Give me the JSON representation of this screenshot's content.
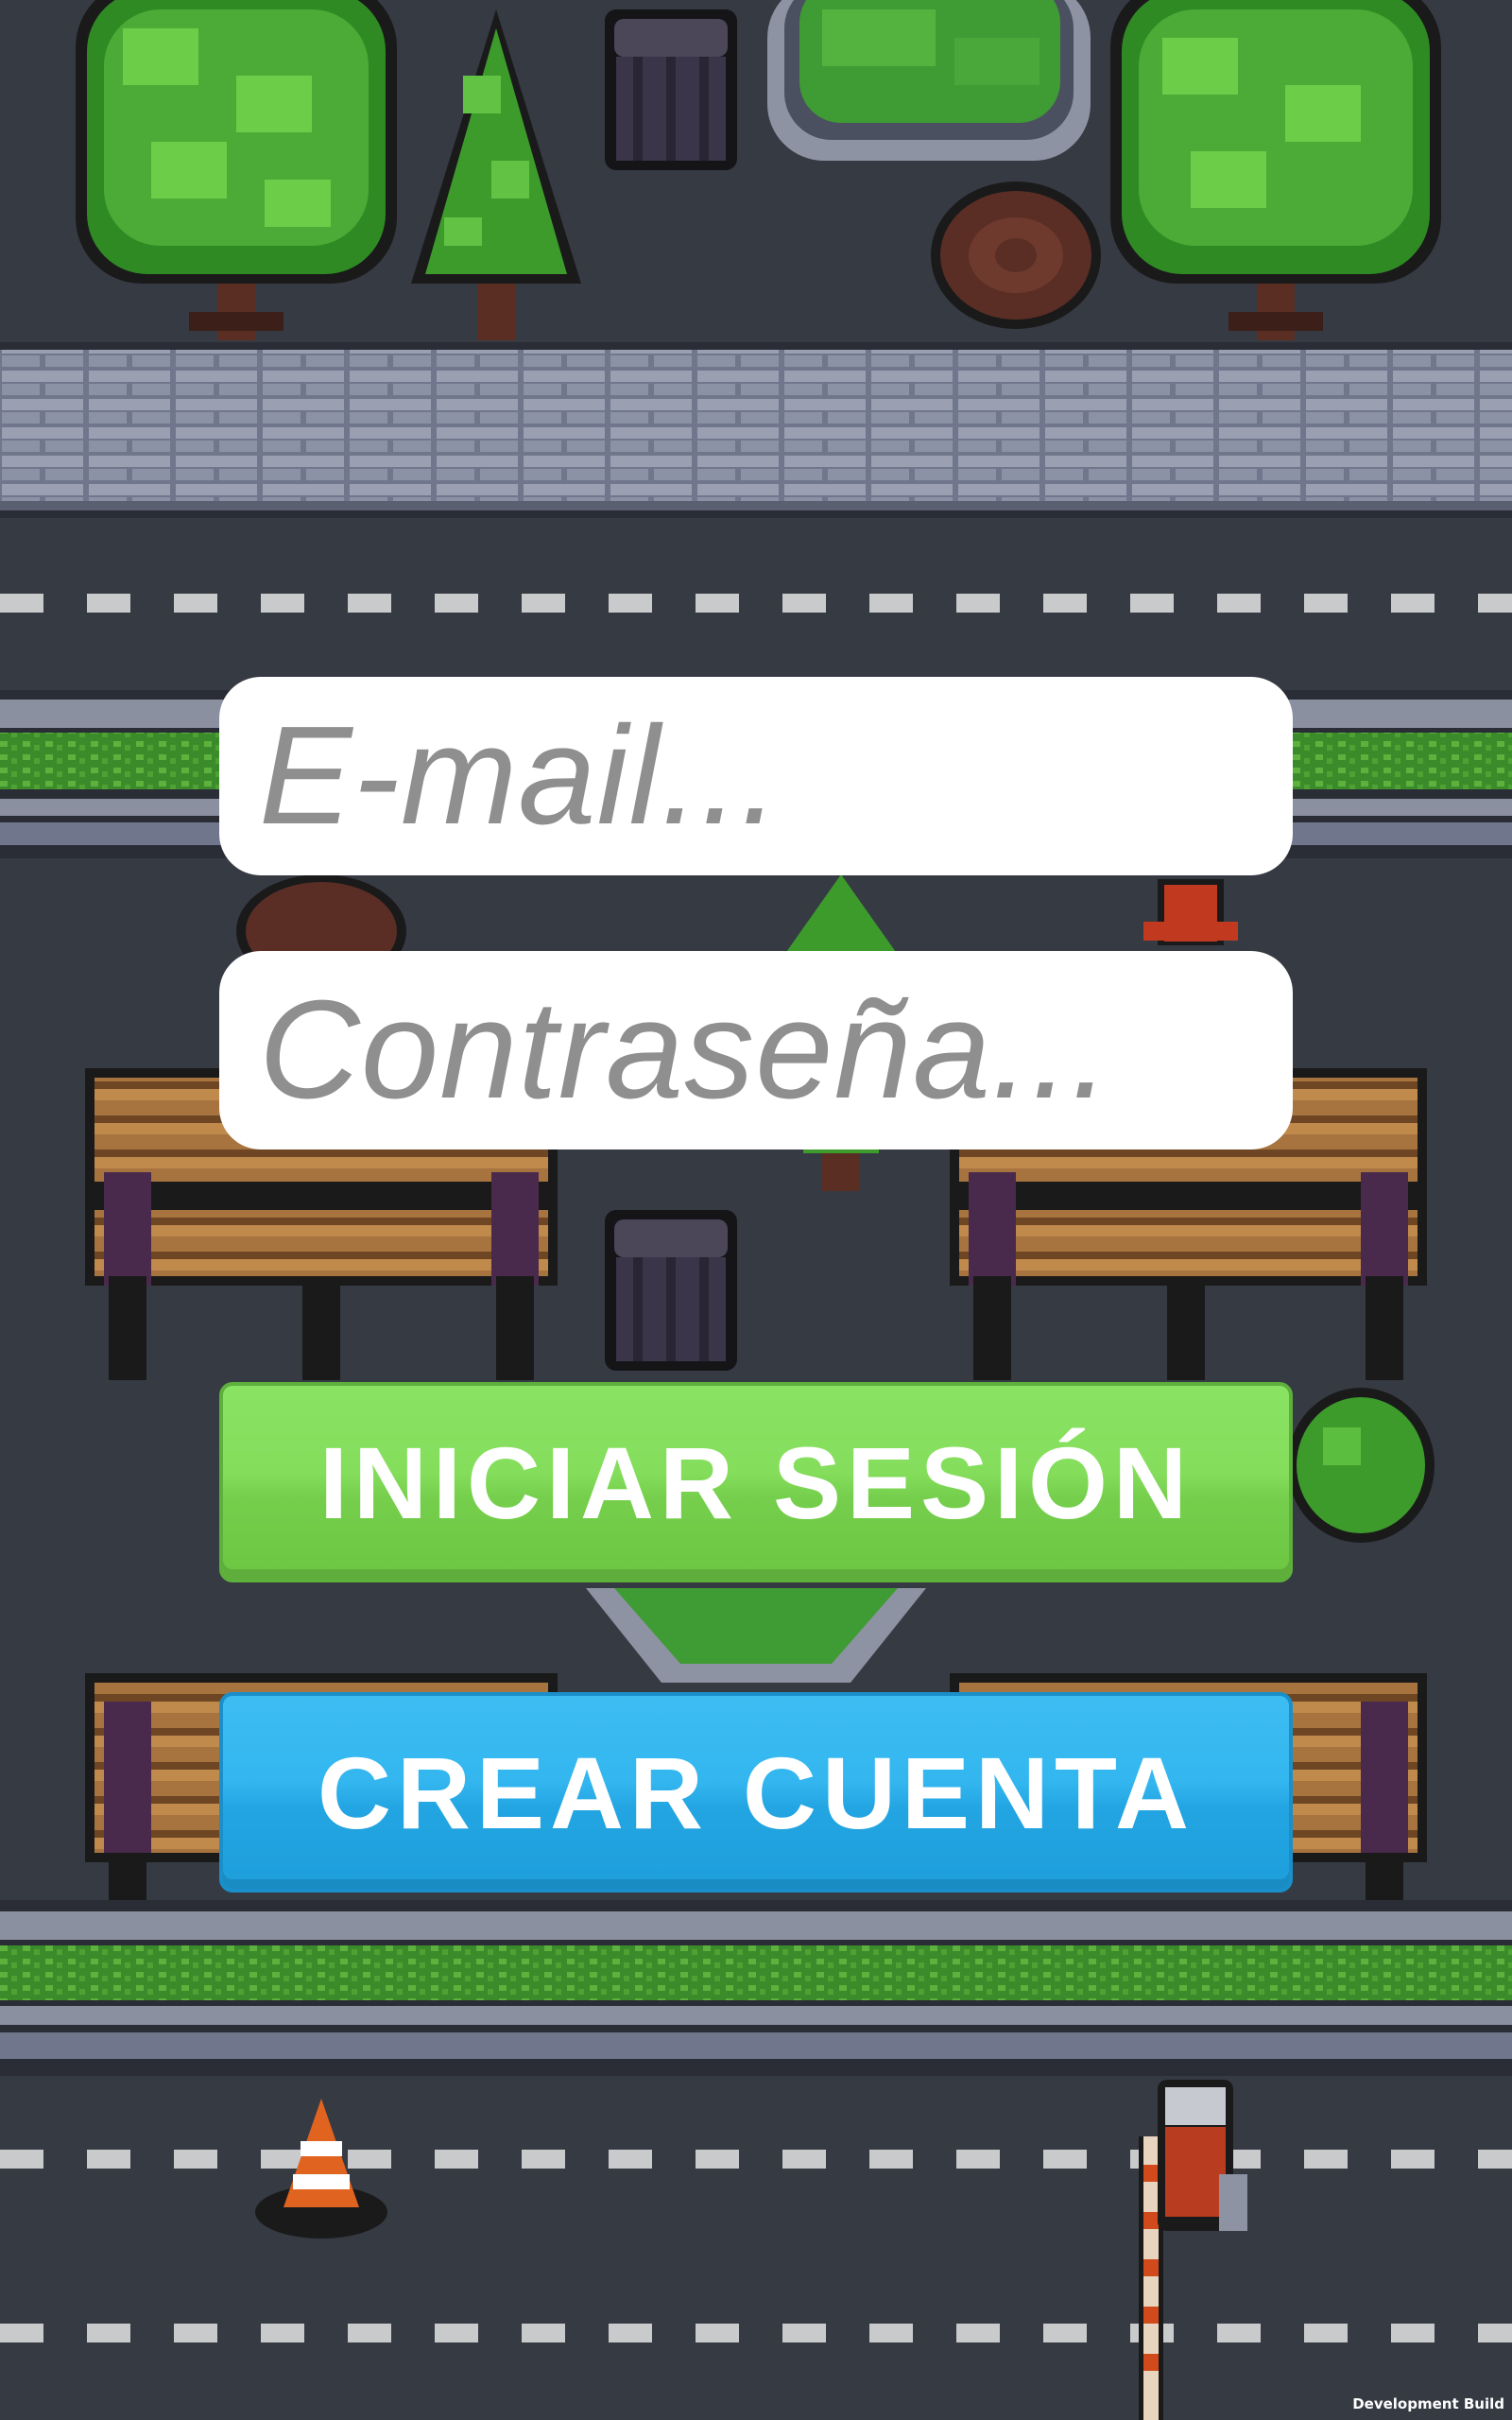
{
  "login_form": {
    "email_placeholder": "E-mail...",
    "password_placeholder": "Contraseña...",
    "login_button_label": "INICIAR SESIÓN",
    "register_button_label": "CREAR CUENTA"
  },
  "footer": {
    "build_label": "Development Build"
  },
  "colors": {
    "road": "#363a43",
    "login_button": "#84de5c",
    "register_button": "#33b6ef",
    "field_background": "#ffffff",
    "placeholder_text": "#8f8f8f"
  },
  "scene_objects": [
    "tree",
    "pine-tree",
    "trash-can",
    "fountain",
    "tree-stump",
    "stone-wall",
    "road-markings",
    "park-bench",
    "fire-hydrant",
    "bush",
    "traffic-cone",
    "barrier-gate"
  ]
}
